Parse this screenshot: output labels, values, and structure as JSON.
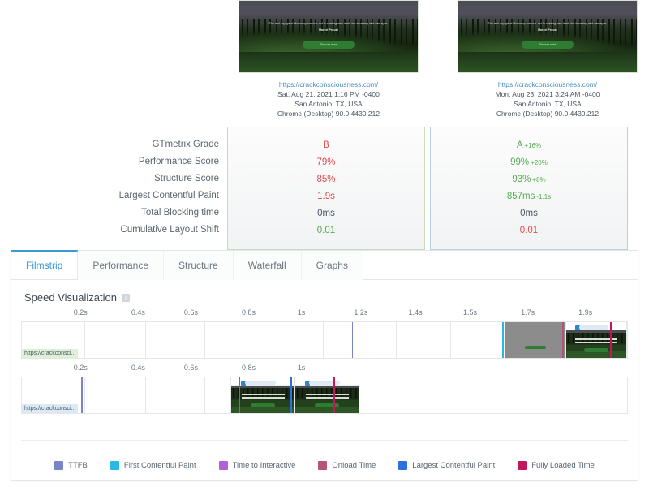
{
  "reports": [
    {
      "url": "https://crackconsciousness.com/",
      "datetime": "Sat, Aug 21, 2021 1:16 PM -0400",
      "location": "San Antonio, TX, USA",
      "browser": "Chrome (Desktop) 90.0.4430.212",
      "accent": "#c9dcc0",
      "quote": "\"The real voyage of discovery consists not in seeking new lands but in seeing with new eyes.\"",
      "quote_author": "Marcel Proust",
      "cta": "Discover more",
      "values": [
        {
          "text": "B",
          "color": "red",
          "delta": ""
        },
        {
          "text": "79%",
          "color": "red",
          "delta": ""
        },
        {
          "text": "85%",
          "color": "red",
          "delta": ""
        },
        {
          "text": "1.9s",
          "color": "red",
          "delta": ""
        },
        {
          "text": "0ms",
          "color": "dark",
          "delta": ""
        },
        {
          "text": "0.01",
          "color": "green",
          "delta": ""
        }
      ]
    },
    {
      "url": "https://crackconsciousness.com/",
      "datetime": "Mon, Aug 23, 2021 3:24 AM -0400",
      "location": "San Antonio, TX, USA",
      "browser": "Chrome (Desktop) 90.0.4430.212",
      "accent": "#b9cfe4",
      "quote": "\"The real voyage of discovery consists not in seeking new lands but in seeing with new eyes.\"",
      "quote_author": "Marcel Proust",
      "cta": "Discover more",
      "values": [
        {
          "text": "A",
          "color": "green",
          "delta": "+16%"
        },
        {
          "text": "99%",
          "color": "green",
          "delta": "+20%"
        },
        {
          "text": "93%",
          "color": "green",
          "delta": "+8%"
        },
        {
          "text": "857ms",
          "color": "green",
          "delta": "-1.1s"
        },
        {
          "text": "0ms",
          "color": "dark",
          "delta": ""
        },
        {
          "text": "0.01",
          "color": "red",
          "delta": ""
        }
      ]
    }
  ],
  "metric_labels": [
    "GTmetrix Grade",
    "Performance Score",
    "Structure Score",
    "Largest Contentful Paint",
    "Total Blocking time",
    "Cumulative Layout Shift"
  ],
  "tabs": [
    {
      "label": "Filmstrip",
      "active": true
    },
    {
      "label": "Performance",
      "active": false
    },
    {
      "label": "Structure",
      "active": false
    },
    {
      "label": "Waterfall",
      "active": false
    },
    {
      "label": "Graphs",
      "active": false
    }
  ],
  "section": {
    "title": "Speed Visualization",
    "help_icon": "info-icon",
    "help_glyph": "i"
  },
  "filmstrips": [
    {
      "tag": "https://crackconsci...",
      "tag_color": "green",
      "ticks": [
        "0.2s",
        "0.4s",
        "0.6s",
        "0.8s",
        "1s",
        "1.2s",
        "1.4s",
        "1.5s",
        "1.7s",
        "1.9s"
      ],
      "tick_pct": [
        9.8,
        19.3,
        28.0,
        37.5,
        46.2,
        56.0,
        65.0,
        74.0,
        83.5,
        93.0
      ],
      "frames": [
        {
          "kind": "blank",
          "width_pct": 10.5
        },
        {
          "kind": "blank",
          "width_pct": 10.0
        },
        {
          "kind": "blank",
          "width_pct": 9.8
        },
        {
          "kind": "blank",
          "width_pct": 9.8
        },
        {
          "kind": "blank",
          "width_pct": 9.8
        },
        {
          "kind": "blank",
          "width_pct": 3.0
        },
        {
          "kind": "blank",
          "width_pct": 9.0
        },
        {
          "kind": "blank",
          "width_pct": 9.0
        },
        {
          "kind": "blank",
          "width_pct": 9.0
        },
        {
          "kind": "gray",
          "width_pct": 10.0
        },
        {
          "kind": "loaded",
          "width_pct": 10.1
        }
      ],
      "markers": [
        {
          "name": "ttfb",
          "pct": 54.5,
          "color": "#7b84c4"
        },
        {
          "name": "first-contentful-paint",
          "pct": 79.4,
          "color": "#29b6e8"
        },
        {
          "name": "time-to-interactive",
          "pct": 84.0,
          "color": "#b45fd6"
        },
        {
          "name": "onload-time",
          "pct": 89.3,
          "color": "#b5537a"
        },
        {
          "name": "fully-loaded-time",
          "pct": 97.2,
          "color": "#c2185b"
        }
      ]
    },
    {
      "tag": "https://crackconsci...",
      "tag_color": "blue",
      "ticks": [
        "0.2s",
        "0.4s",
        "0.6s",
        "0.8s",
        "1s"
      ],
      "tick_pct": [
        9.8,
        19.3,
        28.0,
        37.5,
        46.2
      ],
      "frames": [
        {
          "kind": "blank",
          "width_pct": 10.5
        },
        {
          "kind": "blank",
          "width_pct": 10.0
        },
        {
          "kind": "blank",
          "width_pct": 9.8
        },
        {
          "kind": "blank",
          "width_pct": 4.3
        },
        {
          "kind": "loaded",
          "width_pct": 10.6
        },
        {
          "kind": "loaded",
          "width_pct": 10.6
        }
      ],
      "markers": [
        {
          "name": "ttfb",
          "pct": 9.8,
          "color": "#7b84c4"
        },
        {
          "name": "first-contentful-paint",
          "pct": 26.5,
          "color": "#29b6e8"
        },
        {
          "name": "time-to-interactive",
          "pct": 29.3,
          "color": "#b45fd6"
        },
        {
          "name": "onload-time",
          "pct": 35.8,
          "color": "#b5537a"
        },
        {
          "name": "largest-contentful-paint",
          "pct": 44.4,
          "color": "#2f6fe0"
        },
        {
          "name": "fully-loaded-time",
          "pct": 51.5,
          "color": "#c2185b"
        }
      ]
    }
  ],
  "legend": [
    {
      "label": "TTFB",
      "color": "#7b84c4"
    },
    {
      "label": "First Contentful Paint",
      "color": "#29b6e8"
    },
    {
      "label": "Time to Interactive",
      "color": "#b45fd6"
    },
    {
      "label": "Onload Time",
      "color": "#b5537a"
    },
    {
      "label": "Largest Contentful Paint",
      "color": "#2f6fe0"
    },
    {
      "label": "Fully Loaded Time",
      "color": "#c2185b"
    }
  ]
}
